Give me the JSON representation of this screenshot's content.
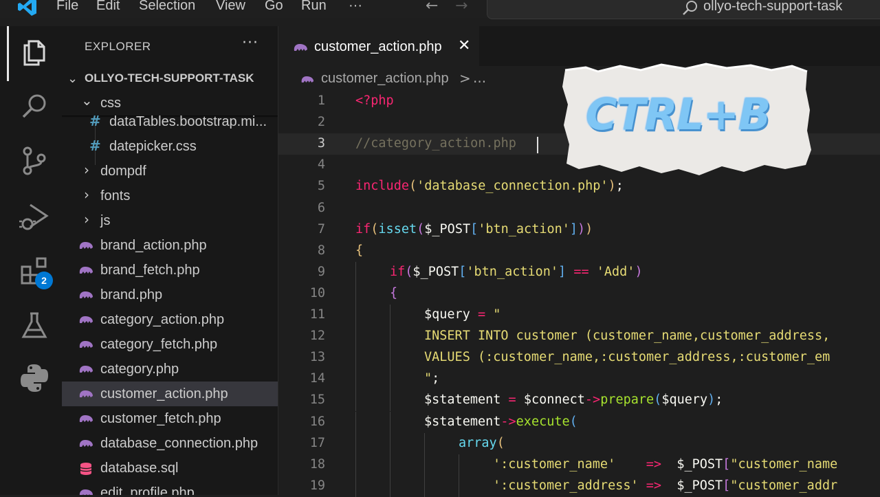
{
  "titlebar": {
    "menu": [
      "File",
      "Edit",
      "Selection",
      "View",
      "Go",
      "Run",
      "···"
    ],
    "command_center": "ollyo-tech-support-task"
  },
  "activity_bar": {
    "icons": [
      "files-icon",
      "search-icon",
      "source-control-icon",
      "run-debug-icon",
      "extensions-icon",
      "testing-icon",
      "python-icon"
    ],
    "extensions_badge": "2"
  },
  "sidebar": {
    "title": "EXPLORER",
    "more": "···",
    "root": "OLLYO-TECH-SUPPORT-TASK",
    "items": [
      {
        "label": "css",
        "type": "folder-open"
      },
      {
        "label": "dataTables.bootstrap.mi...",
        "type": "css"
      },
      {
        "label": "datepicker.css",
        "type": "css"
      },
      {
        "label": "dompdf",
        "type": "folder"
      },
      {
        "label": "fonts",
        "type": "folder"
      },
      {
        "label": "js",
        "type": "folder"
      },
      {
        "label": "brand_action.php",
        "type": "php"
      },
      {
        "label": "brand_fetch.php",
        "type": "php"
      },
      {
        "label": "brand.php",
        "type": "php"
      },
      {
        "label": "category_action.php",
        "type": "php"
      },
      {
        "label": "category_fetch.php",
        "type": "php"
      },
      {
        "label": "category.php",
        "type": "php"
      },
      {
        "label": "customer_action.php",
        "type": "php"
      },
      {
        "label": "customer_fetch.php",
        "type": "php"
      },
      {
        "label": "database_connection.php",
        "type": "php"
      },
      {
        "label": "database.sql",
        "type": "sql"
      },
      {
        "label": "edit_profile.php",
        "type": "php"
      }
    ]
  },
  "tab": {
    "label": "customer_action.php",
    "close": "✕"
  },
  "breadcrumb": {
    "file": "customer_action.php",
    "separator": ">",
    "more": "..."
  },
  "editor": {
    "current_line": 3,
    "lines": [
      {
        "n": "1",
        "indent": 0,
        "tokens": [
          {
            "t": "<?php",
            "c": "#f92672"
          }
        ]
      },
      {
        "n": "2",
        "indent": 0,
        "tokens": []
      },
      {
        "n": "3",
        "indent": 0,
        "tokens": [
          {
            "t": "//category_action.php",
            "c": "#75715e"
          }
        ]
      },
      {
        "n": "4",
        "indent": 0,
        "tokens": []
      },
      {
        "n": "5",
        "indent": 0,
        "tokens": [
          {
            "t": "include",
            "c": "#f92672"
          },
          {
            "t": "(",
            "c": "#e6c07b"
          },
          {
            "t": "'database_connection.php'",
            "c": "#e6db74"
          },
          {
            "t": ")",
            "c": "#e6c07b"
          },
          {
            "t": ";",
            "c": "#f8f8f2"
          }
        ]
      },
      {
        "n": "6",
        "indent": 0,
        "tokens": []
      },
      {
        "n": "7",
        "indent": 0,
        "tokens": [
          {
            "t": "if",
            "c": "#f92672"
          },
          {
            "t": "(",
            "c": "#e6c07b"
          },
          {
            "t": "isset",
            "c": "#66d9ef"
          },
          {
            "t": "(",
            "c": "#c678dd"
          },
          {
            "t": "$_POST",
            "c": "#f8f8f2"
          },
          {
            "t": "[",
            "c": "#61afef"
          },
          {
            "t": "'btn_action'",
            "c": "#e6db74"
          },
          {
            "t": "]",
            "c": "#61afef"
          },
          {
            "t": ")",
            "c": "#c678dd"
          },
          {
            "t": ")",
            "c": "#e6c07b"
          }
        ]
      },
      {
        "n": "8",
        "indent": 0,
        "tokens": [
          {
            "t": "{",
            "c": "#e6c07b"
          }
        ]
      },
      {
        "n": "9",
        "indent": 1,
        "tokens": [
          {
            "t": "if",
            "c": "#f92672"
          },
          {
            "t": "(",
            "c": "#c678dd"
          },
          {
            "t": "$_POST",
            "c": "#f8f8f2"
          },
          {
            "t": "[",
            "c": "#61afef"
          },
          {
            "t": "'btn_action'",
            "c": "#e6db74"
          },
          {
            "t": "]",
            "c": "#61afef"
          },
          {
            "t": " ",
            "c": "#f8f8f2"
          },
          {
            "t": "==",
            "c": "#f92672"
          },
          {
            "t": " ",
            "c": "#f8f8f2"
          },
          {
            "t": "'Add'",
            "c": "#e6db74"
          },
          {
            "t": ")",
            "c": "#c678dd"
          }
        ]
      },
      {
        "n": "10",
        "indent": 1,
        "tokens": [
          {
            "t": "{",
            "c": "#c678dd"
          }
        ]
      },
      {
        "n": "11",
        "indent": 2,
        "tokens": [
          {
            "t": "$query",
            "c": "#f8f8f2"
          },
          {
            "t": " = ",
            "c": "#f92672"
          },
          {
            "t": "\"",
            "c": "#e6db74"
          }
        ]
      },
      {
        "n": "12",
        "indent": 2,
        "tokens": [
          {
            "t": "INSERT INTO customer (customer_name,customer_address,",
            "c": "#e6db74"
          }
        ]
      },
      {
        "n": "13",
        "indent": 2,
        "tokens": [
          {
            "t": "VALUES (:customer_name,:customer_address,:customer_em",
            "c": "#e6db74"
          }
        ]
      },
      {
        "n": "14",
        "indent": 2,
        "tokens": [
          {
            "t": "\"",
            "c": "#e6db74"
          },
          {
            "t": ";",
            "c": "#f8f8f2"
          }
        ]
      },
      {
        "n": "15",
        "indent": 2,
        "tokens": [
          {
            "t": "$statement",
            "c": "#f8f8f2"
          },
          {
            "t": " = ",
            "c": "#f92672"
          },
          {
            "t": "$connect",
            "c": "#f8f8f2"
          },
          {
            "t": "->",
            "c": "#f92672"
          },
          {
            "t": "prepare",
            "c": "#a6e22e"
          },
          {
            "t": "(",
            "c": "#61afef"
          },
          {
            "t": "$query",
            "c": "#f8f8f2"
          },
          {
            "t": ")",
            "c": "#61afef"
          },
          {
            "t": ";",
            "c": "#f8f8f2"
          }
        ]
      },
      {
        "n": "16",
        "indent": 2,
        "tokens": [
          {
            "t": "$statement",
            "c": "#f8f8f2"
          },
          {
            "t": "->",
            "c": "#f92672"
          },
          {
            "t": "execute",
            "c": "#a6e22e"
          },
          {
            "t": "(",
            "c": "#61afef"
          }
        ]
      },
      {
        "n": "17",
        "indent": 3,
        "tokens": [
          {
            "t": "array",
            "c": "#66d9ef"
          },
          {
            "t": "(",
            "c": "#e6c07b"
          }
        ]
      },
      {
        "n": "18",
        "indent": 4,
        "tokens": [
          {
            "t": "':customer_name'",
            "c": "#e6db74"
          },
          {
            "t": "    ",
            "c": "#f8f8f2"
          },
          {
            "t": "=>",
            "c": "#f92672"
          },
          {
            "t": "  ",
            "c": "#f8f8f2"
          },
          {
            "t": "$_POST",
            "c": "#f8f8f2"
          },
          {
            "t": "[",
            "c": "#c678dd"
          },
          {
            "t": "\"customer_name",
            "c": "#e6db74"
          }
        ]
      },
      {
        "n": "19",
        "indent": 4,
        "tokens": [
          {
            "t": "':customer_address'",
            "c": "#e6db74"
          },
          {
            "t": " ",
            "c": "#f8f8f2"
          },
          {
            "t": "=>",
            "c": "#f92672"
          },
          {
            "t": "  ",
            "c": "#f8f8f2"
          },
          {
            "t": "$_POST",
            "c": "#f8f8f2"
          },
          {
            "t": "[",
            "c": "#c678dd"
          },
          {
            "t": "\"customer_addr",
            "c": "#e6db74"
          }
        ]
      }
    ]
  },
  "overlay": {
    "text": "CTRL+B"
  }
}
